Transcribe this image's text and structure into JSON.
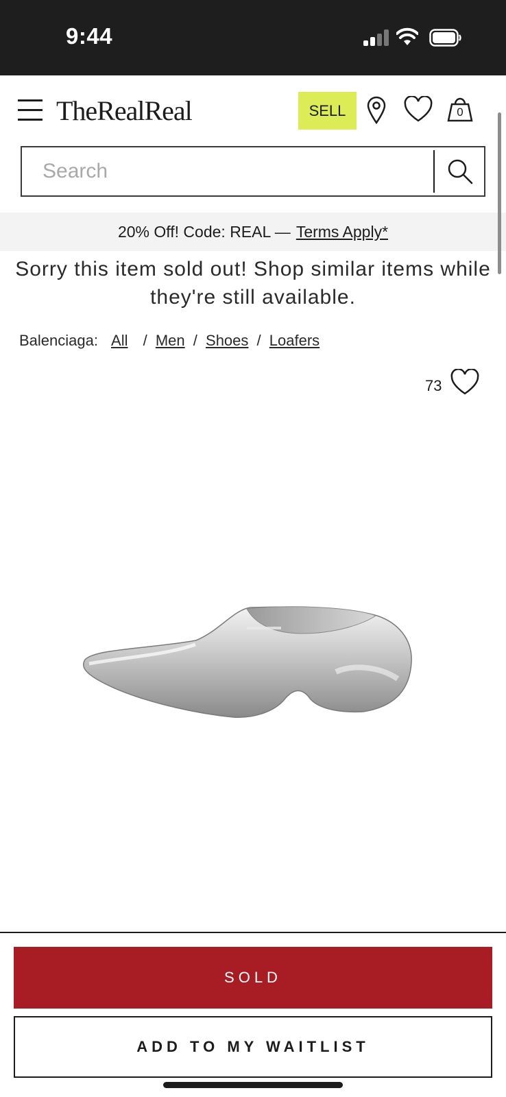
{
  "status_bar": {
    "time": "9:44"
  },
  "header": {
    "logo": "TheRealReal",
    "sell_label": "SELL",
    "cart_count": "0"
  },
  "search": {
    "placeholder": "Search"
  },
  "promo": {
    "text": "20% Off! Code: REAL —",
    "link": "Terms Apply*"
  },
  "sold_message": "Sorry this item sold out! Shop similar items while they're still available.",
  "breadcrumb": {
    "brand": "Balenciaga:",
    "items": [
      "All",
      "Men",
      "Shoes",
      "Loafers"
    ]
  },
  "favorites": {
    "count": "73"
  },
  "actions": {
    "sold_label": "SOLD",
    "waitlist_label": "ADD TO MY WAITLIST"
  },
  "colors": {
    "status_bar": "#1e1e1e",
    "sell_button": "#dbec57",
    "sold_button": "#a71d23"
  },
  "icons": [
    "menu-icon",
    "location-pin-icon",
    "heart-icon",
    "shopping-bag-icon",
    "search-icon"
  ]
}
